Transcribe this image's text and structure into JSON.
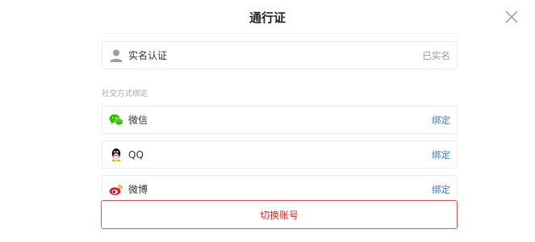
{
  "dialog": {
    "title": "通行证"
  },
  "account": {
    "realname_label": "实名认证",
    "realname_status": "已实名"
  },
  "social": {
    "section_label": "社交方式绑定",
    "items": [
      {
        "label": "微信",
        "action": "绑定",
        "icon": "wechat-icon"
      },
      {
        "label": "QQ",
        "action": "绑定",
        "icon": "qq-icon"
      },
      {
        "label": "微博",
        "action": "绑定",
        "icon": "weibo-icon"
      }
    ]
  },
  "footer": {
    "switch_label": "切换账号"
  },
  "colors": {
    "accent_link": "#3a7bd5",
    "danger": "#c9302c",
    "wechat": "#2dc100"
  }
}
